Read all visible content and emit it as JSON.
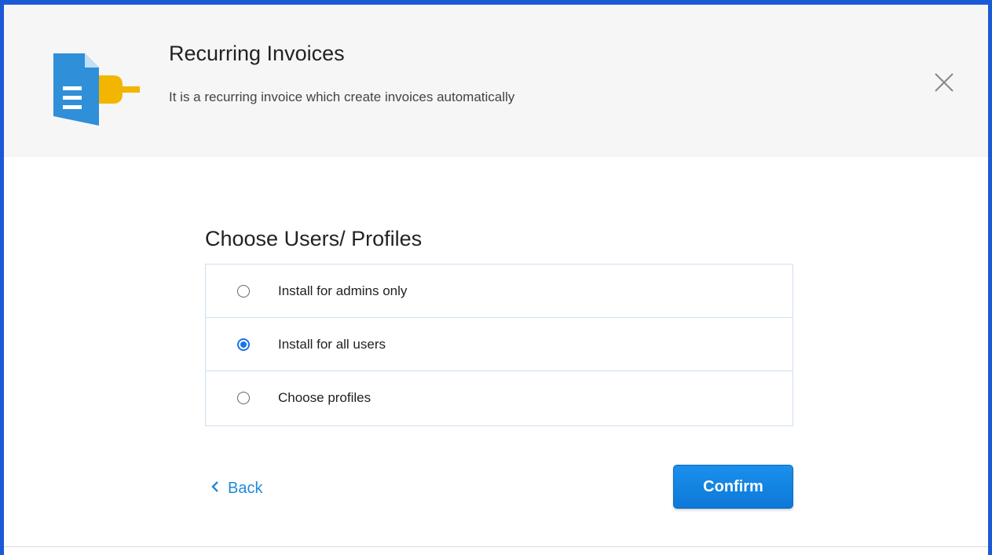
{
  "header": {
    "title": "Recurring Invoices",
    "subtitle": "It is a recurring invoice which create invoices automatically",
    "icon": "invoice-plugin-icon",
    "close_icon": "close-icon"
  },
  "section": {
    "heading": "Choose Users/ Profiles"
  },
  "options": [
    {
      "label": "Install for admins only",
      "selected": false
    },
    {
      "label": "Install for all users",
      "selected": true
    },
    {
      "label": "Choose profiles",
      "selected": false
    }
  ],
  "footer": {
    "back_label": "Back",
    "confirm_label": "Confirm"
  },
  "colors": {
    "frame_border": "#1a5ad6",
    "header_bg": "#f6f6f6",
    "accent": "#1a73e8",
    "link": "#1f8ad8",
    "icon_doc": "#2f8fd8",
    "icon_plug": "#f2b600"
  }
}
